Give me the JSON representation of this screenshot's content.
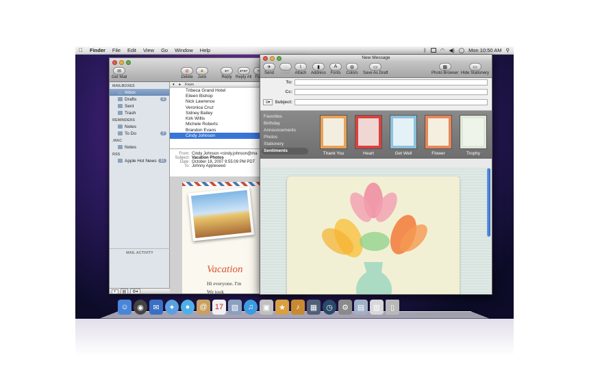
{
  "menubar": {
    "app": "Finder",
    "items": [
      "File",
      "Edit",
      "View",
      "Go",
      "Window",
      "Help"
    ],
    "clock": "Mon 10:50 AM"
  },
  "mail": {
    "toolbar": {
      "get_mail": "Get Mail",
      "delete": "Delete",
      "junk": "Junk",
      "reply": "Reply",
      "reply_all": "Reply All",
      "forward": "Forw"
    },
    "sidebar": {
      "mailboxes_head": "MAILBOXES",
      "inbox": "Inbox",
      "drafts": "Drafts",
      "drafts_count": "3",
      "sent": "Sent",
      "trash": "Trash",
      "reminders_head": "REMINDERS",
      "notes": "Notes",
      "todo": "To Do",
      "todo_count": "7",
      "mac_head": ".MAC",
      "mac_notes": "Notes",
      "rss_head": "RSS",
      "apple_news": "Apple Hot News",
      "apple_news_count": "11",
      "activity": "MAIL ACTIVITY",
      "bottom_add": "+",
      "bottom_action": "⚙▾"
    },
    "list": {
      "col_from": "From",
      "rows": [
        "Tribeca Grand Hotel",
        "Eileen Bishop",
        "Nick Lawrence",
        "Veronica Cruz",
        "Sidney Bailey",
        "Kirk Willis",
        "Michele Roberts",
        "Brandon Evans",
        "Cindy Johnson"
      ]
    },
    "header": {
      "from_k": "From:",
      "from_v": "Cindy Johnson <cindy.johnson@ma",
      "subject_k": "Subject:",
      "subject_v": "Vacation Photos",
      "date_k": "Date:",
      "date_v": "October 18, 2007 9:55:09 PM PDT",
      "to_k": "To:",
      "to_v": "Johnny Appleseed"
    },
    "body": {
      "title": "Vacation",
      "line1": "Hi everyone. I'm",
      "line2": "We took"
    }
  },
  "compose": {
    "title": "New Message",
    "toolbar": {
      "send": "Send",
      "chat": "Chat",
      "attach": "Attach",
      "address": "Address",
      "fonts": "Fonts",
      "colors": "Colors",
      "save_draft": "Save As Draft",
      "photo_browser": "Photo Browser",
      "hide_stationery": "Hide Stationery"
    },
    "fields": {
      "to": "To:",
      "cc": "Cc:",
      "subject": "Subject:"
    },
    "categories": [
      "Favorites",
      "Birthday",
      "Announcements",
      "Photos",
      "Stationery",
      "Sentiments"
    ],
    "selected_category": "Sentiments",
    "templates": [
      {
        "name": "Thank You",
        "color": "#e8a25a"
      },
      {
        "name": "Heart",
        "color": "#d9423e"
      },
      {
        "name": "Get Well",
        "color": "#8cc2dc"
      },
      {
        "name": "Flower",
        "color": "#e8875a"
      },
      {
        "name": "Trophy",
        "color": "#dfe8d8"
      }
    ]
  }
}
